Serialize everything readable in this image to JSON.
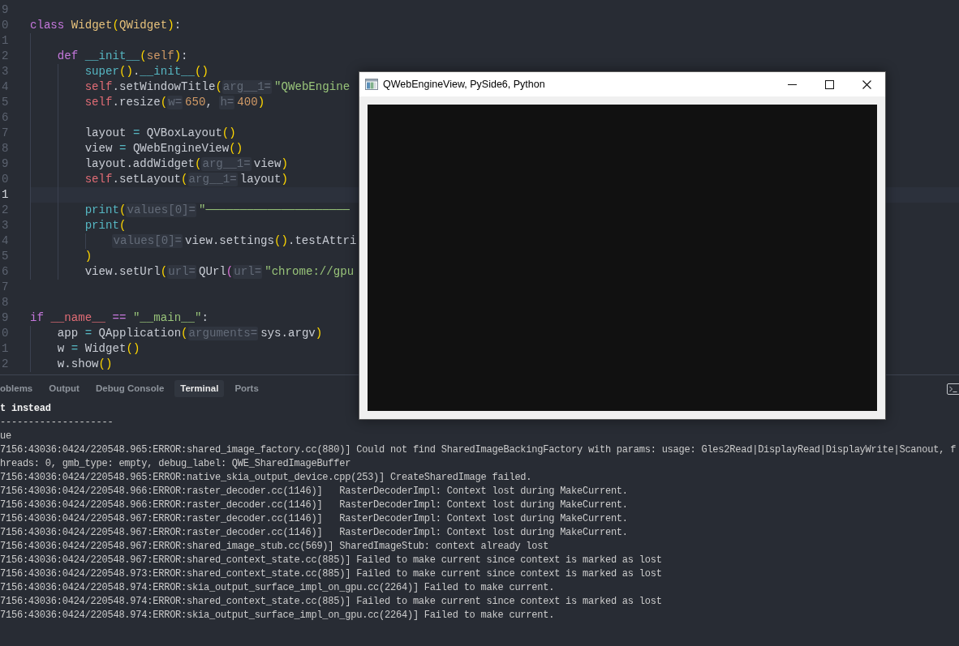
{
  "editor": {
    "lines": [
      {
        "number": "9",
        "current": false
      },
      {
        "number": "0",
        "current": false,
        "tokens": [
          {
            "kind": "keyword",
            "text": "class"
          },
          {
            "kind": "type",
            "text": " Widget"
          },
          {
            "kind": "bracket",
            "text": "("
          },
          {
            "kind": "type",
            "text": "QWidget"
          },
          {
            "kind": "bracket",
            "text": ")"
          },
          {
            "kind": "plain",
            "text": ":"
          }
        ],
        "children": [
          {
            "number": "1",
            "current": false
          },
          {
            "number": "2",
            "current": false,
            "tokens": [
              {
                "kind": "keyword",
                "text": "def"
              },
              {
                "kind": "func",
                "text": " __init__"
              },
              {
                "kind": "bracket",
                "text": "("
              },
              {
                "kind": "param",
                "text": "self"
              },
              {
                "kind": "bracket",
                "text": ")"
              },
              {
                "kind": "plain",
                "text": ":"
              }
            ],
            "children": [
              {
                "number": "3",
                "current": false,
                "tokens": [
                  {
                    "kind": "func",
                    "text": "super"
                  },
                  {
                    "kind": "bracket",
                    "text": "()"
                  },
                  {
                    "kind": "plain",
                    "text": "."
                  },
                  {
                    "kind": "func",
                    "text": "__init__"
                  },
                  {
                    "kind": "bracket",
                    "text": "()"
                  }
                ]
              },
              {
                "number": "4",
                "current": false,
                "tokens": [
                  {
                    "kind": "self",
                    "text": "self"
                  },
                  {
                    "kind": "plain",
                    "text": ".setWindowTitle"
                  },
                  {
                    "kind": "bracket",
                    "text": "("
                  },
                  {
                    "kind": "hint",
                    "text": "arg__1="
                  },
                  {
                    "kind": "string",
                    "text": "\"QWebEngine"
                  }
                ]
              },
              {
                "number": "5",
                "current": false,
                "tokens": [
                  {
                    "kind": "self",
                    "text": "self"
                  },
                  {
                    "kind": "plain",
                    "text": ".resize"
                  },
                  {
                    "kind": "bracket",
                    "text": "("
                  },
                  {
                    "kind": "hint",
                    "text": "w="
                  },
                  {
                    "kind": "number",
                    "text": "650"
                  },
                  {
                    "kind": "plain",
                    "text": ", "
                  },
                  {
                    "kind": "hint",
                    "text": "h="
                  },
                  {
                    "kind": "number",
                    "text": "400"
                  },
                  {
                    "kind": "bracket",
                    "text": ")"
                  }
                ]
              },
              {
                "number": "6",
                "current": false
              },
              {
                "number": "7",
                "current": false,
                "tokens": [
                  {
                    "kind": "plain",
                    "text": "layout "
                  },
                  {
                    "kind": "operator",
                    "text": "="
                  },
                  {
                    "kind": "plain",
                    "text": " QVBoxLayout"
                  },
                  {
                    "kind": "bracket",
                    "text": "()"
                  }
                ]
              },
              {
                "number": "8",
                "current": false,
                "tokens": [
                  {
                    "kind": "plain",
                    "text": "view "
                  },
                  {
                    "kind": "operator",
                    "text": "="
                  },
                  {
                    "kind": "plain",
                    "text": " QWebEngineView"
                  },
                  {
                    "kind": "bracket",
                    "text": "()"
                  }
                ]
              },
              {
                "number": "9",
                "current": false,
                "tokens": [
                  {
                    "kind": "plain",
                    "text": "layout.addWidget"
                  },
                  {
                    "kind": "bracket",
                    "text": "("
                  },
                  {
                    "kind": "hint",
                    "text": "arg__1="
                  },
                  {
                    "kind": "plain",
                    "text": "view"
                  },
                  {
                    "kind": "bracket",
                    "text": ")"
                  }
                ]
              },
              {
                "number": "0",
                "current": false,
                "tokens": [
                  {
                    "kind": "self",
                    "text": "self"
                  },
                  {
                    "kind": "plain",
                    "text": ".setLayout"
                  },
                  {
                    "kind": "bracket",
                    "text": "("
                  },
                  {
                    "kind": "hint",
                    "text": "arg__1="
                  },
                  {
                    "kind": "plain",
                    "text": "layout"
                  },
                  {
                    "kind": "bracket",
                    "text": ")"
                  }
                ]
              },
              {
                "number": "1",
                "current": true
              },
              {
                "number": "2",
                "current": false,
                "tokens": [
                  {
                    "kind": "func",
                    "text": "print"
                  },
                  {
                    "kind": "bracket",
                    "text": "("
                  },
                  {
                    "kind": "hint",
                    "text": "values[0]="
                  },
                  {
                    "kind": "string",
                    "text": "\"─────────────────────"
                  }
                ]
              },
              {
                "number": "3",
                "current": false,
                "tokens": [
                  {
                    "kind": "func",
                    "text": "print"
                  },
                  {
                    "kind": "bracket",
                    "text": "("
                  }
                ],
                "children": [
                  {
                    "number": "4",
                    "current": false,
                    "tokens": [
                      {
                        "kind": "hint",
                        "text": "values[0]="
                      },
                      {
                        "kind": "plain",
                        "text": "view.settings"
                      },
                      {
                        "kind": "bracket",
                        "text": "()"
                      },
                      {
                        "kind": "plain",
                        "text": ".testAttri"
                      }
                    ]
                  }
                ]
              },
              {
                "number": "5",
                "current": false,
                "tokens": [
                  {
                    "kind": "bracket",
                    "text": ")"
                  }
                ]
              },
              {
                "number": "6",
                "current": false,
                "tokens": [
                  {
                    "kind": "plain",
                    "text": "view.setUrl"
                  },
                  {
                    "kind": "bracket",
                    "text": "("
                  },
                  {
                    "kind": "hint",
                    "text": "url="
                  },
                  {
                    "kind": "plain",
                    "text": "QUrl"
                  },
                  {
                    "kind": "bracket2",
                    "text": "("
                  },
                  {
                    "kind": "hint",
                    "text": "url="
                  },
                  {
                    "kind": "string",
                    "text": "\"chrome://gpu"
                  }
                ]
              }
            ]
          }
        ]
      },
      {
        "number": "7",
        "current": false
      },
      {
        "number": "8",
        "current": false
      },
      {
        "number": "9",
        "current": false,
        "tokens": [
          {
            "kind": "keyword",
            "text": "if"
          },
          {
            "kind": "dunder",
            "text": " __name__"
          },
          {
            "kind": "keyword",
            "text": " =="
          },
          {
            "kind": "string",
            "text": " \"__main__\""
          },
          {
            "kind": "plain",
            "text": ":"
          }
        ],
        "children": [
          {
            "number": "0",
            "current": false,
            "tokens": [
              {
                "kind": "plain",
                "text": "app "
              },
              {
                "kind": "operator",
                "text": "="
              },
              {
                "kind": "plain",
                "text": " QApplication"
              },
              {
                "kind": "bracket",
                "text": "("
              },
              {
                "kind": "hint",
                "text": "arguments="
              },
              {
                "kind": "plain",
                "text": "sys.argv"
              },
              {
                "kind": "bracket",
                "text": ")"
              }
            ]
          },
          {
            "number": "1",
            "current": false,
            "tokens": [
              {
                "kind": "plain",
                "text": "w "
              },
              {
                "kind": "operator",
                "text": "="
              },
              {
                "kind": "plain",
                "text": " Widget"
              },
              {
                "kind": "bracket",
                "text": "()"
              }
            ]
          },
          {
            "number": "2",
            "current": false,
            "tokens": [
              {
                "kind": "plain",
                "text": "w.show"
              },
              {
                "kind": "bracket",
                "text": "()"
              }
            ]
          }
        ]
      }
    ]
  },
  "panel": {
    "tabs": [
      {
        "label": "oblems",
        "selected": false
      },
      {
        "label": "Output",
        "selected": false
      },
      {
        "label": "Debug Console",
        "selected": false
      },
      {
        "label": "Terminal",
        "selected": true
      },
      {
        "label": "Ports",
        "selected": false
      }
    ],
    "terminal_lines": [
      {
        "text": "t instead",
        "bold": true
      },
      {
        "text": "--------------------",
        "bold": false
      },
      {
        "text": "ue",
        "bold": false
      },
      {
        "text": "7156:43036:0424/220548.965:ERROR:shared_image_factory.cc(880)] Could not find SharedImageBackingFactory with params: usage: Gles2Read|DisplayRead|DisplayWrite|Scanout, f",
        "bold": false
      },
      {
        "text": "hreads: 0, gmb_type: empty, debug_label: QWE_SharedImageBuffer",
        "bold": false
      },
      {
        "text": "7156:43036:0424/220548.965:ERROR:native_skia_output_device.cpp(253)] CreateSharedImage failed.",
        "bold": false
      },
      {
        "text": "7156:43036:0424/220548.966:ERROR:raster_decoder.cc(1146)]   RasterDecoderImpl: Context lost during MakeCurrent.",
        "bold": false
      },
      {
        "text": "7156:43036:0424/220548.966:ERROR:raster_decoder.cc(1146)]   RasterDecoderImpl: Context lost during MakeCurrent.",
        "bold": false
      },
      {
        "text": "7156:43036:0424/220548.967:ERROR:raster_decoder.cc(1146)]   RasterDecoderImpl: Context lost during MakeCurrent.",
        "bold": false
      },
      {
        "text": "7156:43036:0424/220548.967:ERROR:raster_decoder.cc(1146)]   RasterDecoderImpl: Context lost during MakeCurrent.",
        "bold": false
      },
      {
        "text": "7156:43036:0424/220548.967:ERROR:shared_image_stub.cc(569)] SharedImageStub: context already lost",
        "bold": false
      },
      {
        "text": "7156:43036:0424/220548.967:ERROR:shared_context_state.cc(885)] Failed to make current since context is marked as lost",
        "bold": false
      },
      {
        "text": "7156:43036:0424/220548.973:ERROR:shared_context_state.cc(885)] Failed to make current since context is marked as lost",
        "bold": false
      },
      {
        "text": "7156:43036:0424/220548.974:ERROR:skia_output_surface_impl_on_gpu.cc(2264)] Failed to make current.",
        "bold": false
      },
      {
        "text": "7156:43036:0424/220548.974:ERROR:shared_context_state.cc(885)] Failed to make current since context is marked as lost",
        "bold": false
      },
      {
        "text": "7156:43036:0424/220548.974:ERROR:skia_output_surface_impl_on_gpu.cc(2264)] Failed to make current.",
        "bold": false
      }
    ]
  },
  "window": {
    "title": "QWebEngineView, PySide6, Python"
  }
}
